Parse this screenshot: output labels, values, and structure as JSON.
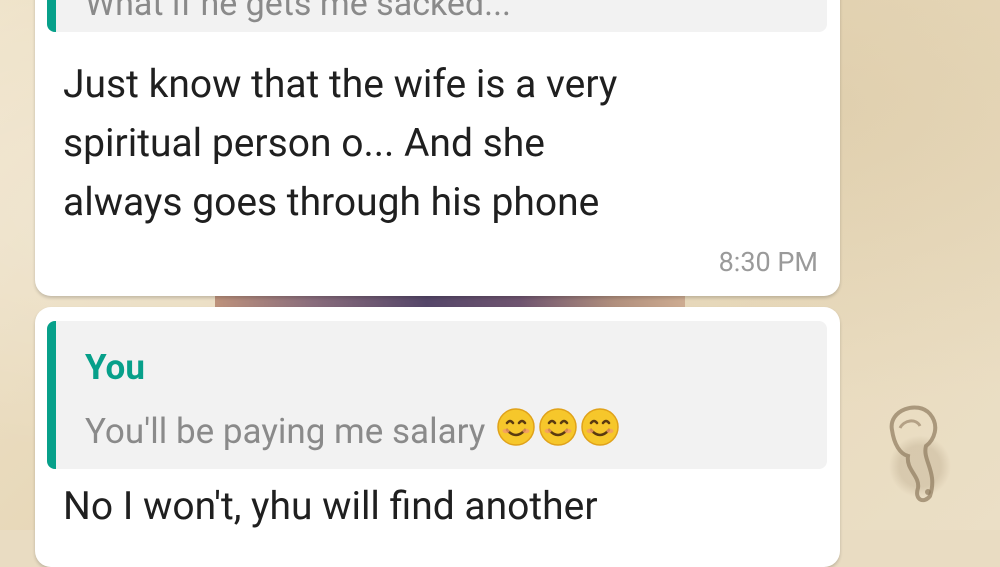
{
  "messages": [
    {
      "quote": {
        "text": "What if he gets me sacked..."
      },
      "lines": [
        "Just know that the wife is a very",
        "spiritual person o... And she",
        "always goes through his phone"
      ],
      "time": "8:30 PM"
    },
    {
      "quote": {
        "author": "You",
        "text": "You'll be paying me salary",
        "emojis": [
          "smiling-face-icon",
          "smiling-face-icon",
          "smiling-face-icon"
        ]
      },
      "lines": [
        "No I won't, yhu will find another"
      ]
    }
  ],
  "colors": {
    "accent": "#07a08a",
    "bubble": "#ffffff",
    "quote_bg": "#f2f2f2",
    "timestamp": "#9a9a9a"
  }
}
